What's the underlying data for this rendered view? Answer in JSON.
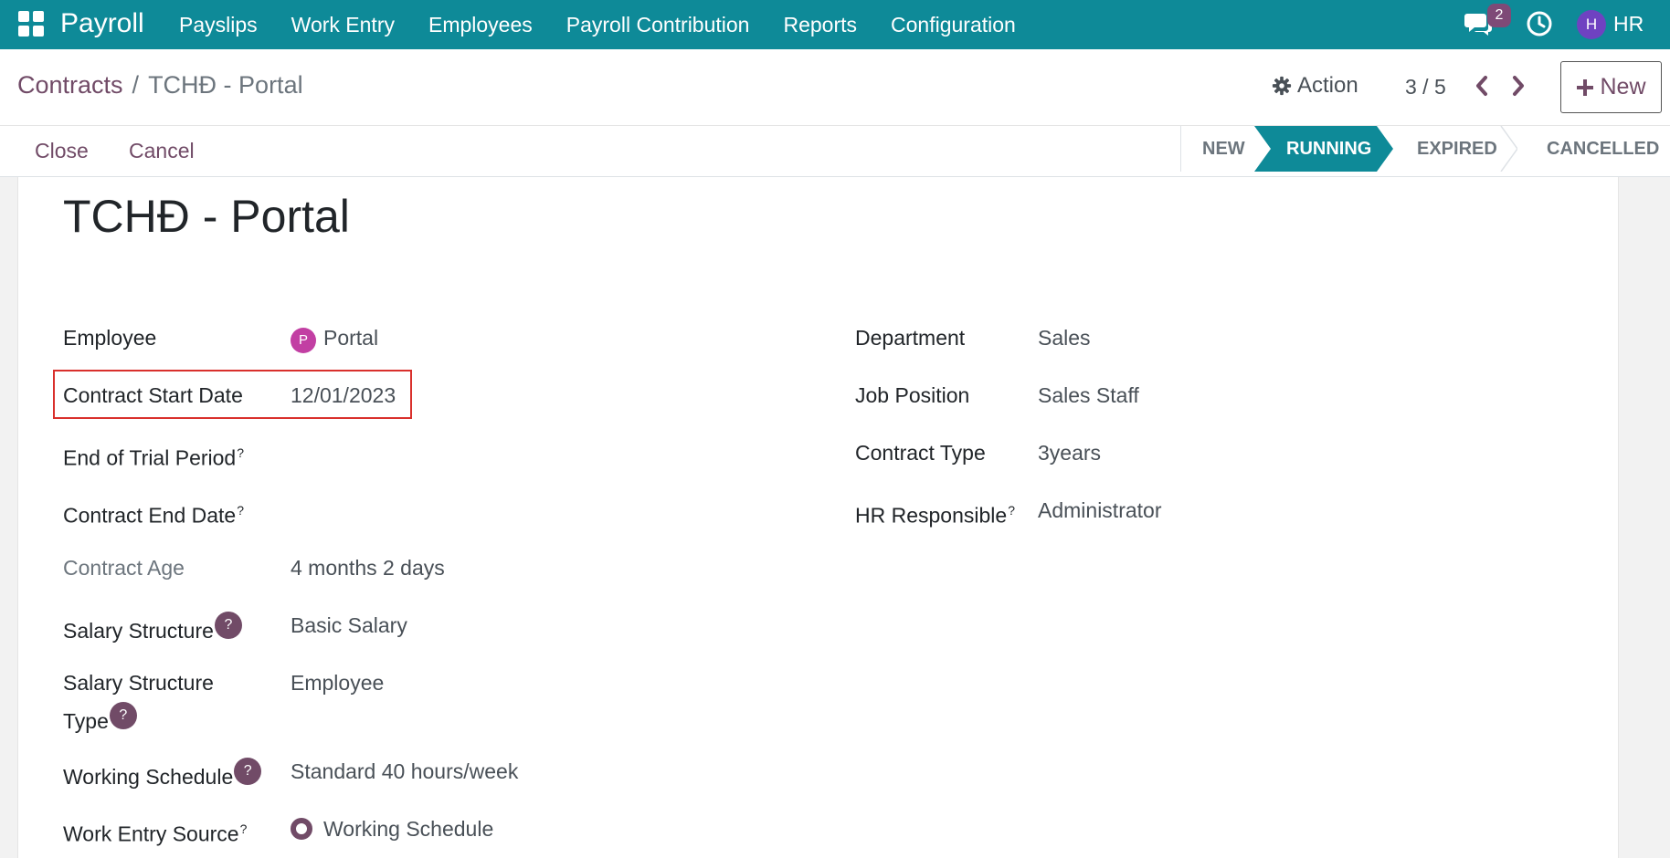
{
  "navbar": {
    "app_name": "Payroll",
    "menu": [
      "Payslips",
      "Work Entry",
      "Employees",
      "Payroll Contribution",
      "Reports",
      "Configuration"
    ],
    "chat_count": "2",
    "user_initial": "H",
    "user_name": "HR",
    "color": "#0e8a98"
  },
  "control": {
    "breadcrumb_parent": "Contracts",
    "breadcrumb_separator": "/",
    "breadcrumb_current": "TCHĐ - Portal",
    "action_label": "Action",
    "pager": "3 / 5",
    "new_label": "New"
  },
  "buttons": {
    "close": "Close",
    "cancel": "Cancel"
  },
  "status": {
    "stages": [
      "NEW",
      "RUNNING",
      "EXPIRED",
      "CANCELLED"
    ],
    "active": "RUNNING",
    "active_color": "#0e8a98"
  },
  "form": {
    "title": "TCHĐ - Portal",
    "left_fields": [
      {
        "label": "Employee",
        "value": "Portal",
        "avatar": "P"
      },
      {
        "label": "Contract Start Date",
        "value": "12/01/2023"
      },
      {
        "label": "End of Trial Period",
        "help": "?",
        "value": ""
      },
      {
        "label": "Contract End Date",
        "help": "?",
        "value": ""
      },
      {
        "label": "Contract Age",
        "value": "4 months 2 days"
      },
      {
        "label": "Salary Structure",
        "help": "?",
        "value": "Basic Salary"
      },
      {
        "label_line1": "Salary Structure",
        "label_line2": "Type",
        "help": "?",
        "value": "Employee"
      },
      {
        "label": "Working Schedule",
        "help": "?",
        "value": "Standard 40 hours/week"
      },
      {
        "label": "Work Entry Source",
        "help": "?",
        "value": "Working Schedule"
      }
    ],
    "right_fields": [
      {
        "label": "Department",
        "value": "Sales"
      },
      {
        "label": "Job Position",
        "value": "Sales Staff"
      },
      {
        "label": "Contract Type",
        "value": "3years"
      },
      {
        "label": "HR Responsible",
        "help": "?",
        "value": "Administrator"
      }
    ]
  }
}
